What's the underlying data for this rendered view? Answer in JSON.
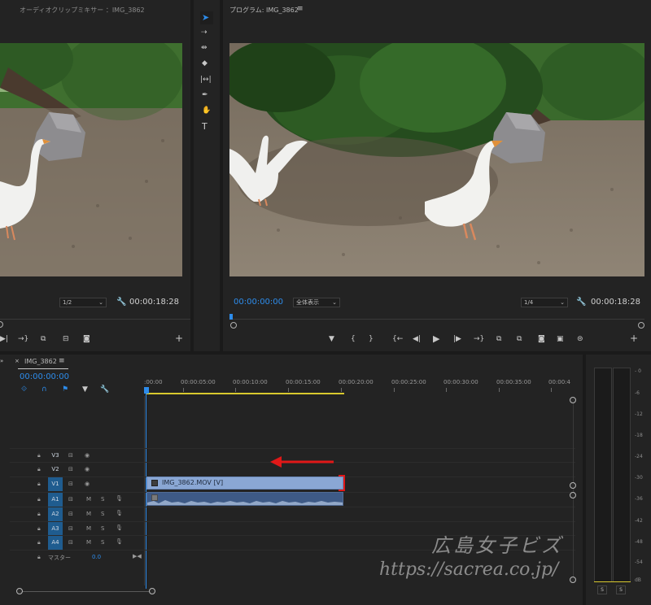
{
  "source_monitor": {
    "title": "オーディオクリップミキサー ：IMG_3862",
    "resolution": "1/2",
    "duration": "00:00:18:28"
  },
  "tools": [
    "selection-tool",
    "track-select-tool",
    "ripple-edit-tool",
    "razor-tool",
    "slip-tool",
    "pen-tool",
    "hand-tool",
    "type-tool"
  ],
  "program_monitor": {
    "title": "プログラム: IMG_3862",
    "timecode": "00:00:00:00",
    "zoom": "全体表示",
    "resolution": "1/4",
    "duration": "00:00:18:28",
    "playhead_fraction": 0.0
  },
  "timeline": {
    "sequence_tab": "IMG_3862",
    "timecode": "00:00:00:00",
    "ruler": [
      ":00:00",
      "00:00:05:00",
      "00:00:10:00",
      "00:00:15:00",
      "00:00:20:00",
      "00:00:25:00",
      "00:00:30:00",
      "00:00:35:00",
      "00:00:4"
    ],
    "video_tracks": [
      "V3",
      "V2",
      "V1"
    ],
    "audio_tracks": [
      "A1",
      "A2",
      "A3",
      "A4"
    ],
    "mute_label": "M",
    "solo_label": "S",
    "master_label": "マスター",
    "master_value": "0.0",
    "video_clip": "IMG_3862.MOV [V]"
  },
  "audio_meter": {
    "scale": [
      "- 0",
      "-6",
      "-12",
      "-18",
      "-24",
      "-30",
      "-36",
      "-42",
      "-48",
      "-54",
      "dB"
    ],
    "solo_buttons": [
      "S",
      "S"
    ]
  },
  "watermark": {
    "line1": "広島女子ビズ",
    "line2": "https://sacrea.co.jp/"
  },
  "colors": {
    "accent_blue": "#2d8ceb",
    "clip_video": "#8aa7d4",
    "clip_audio": "#3e5a86",
    "arrow_red": "#e01818",
    "work_area_yellow": "#d8c92e"
  }
}
